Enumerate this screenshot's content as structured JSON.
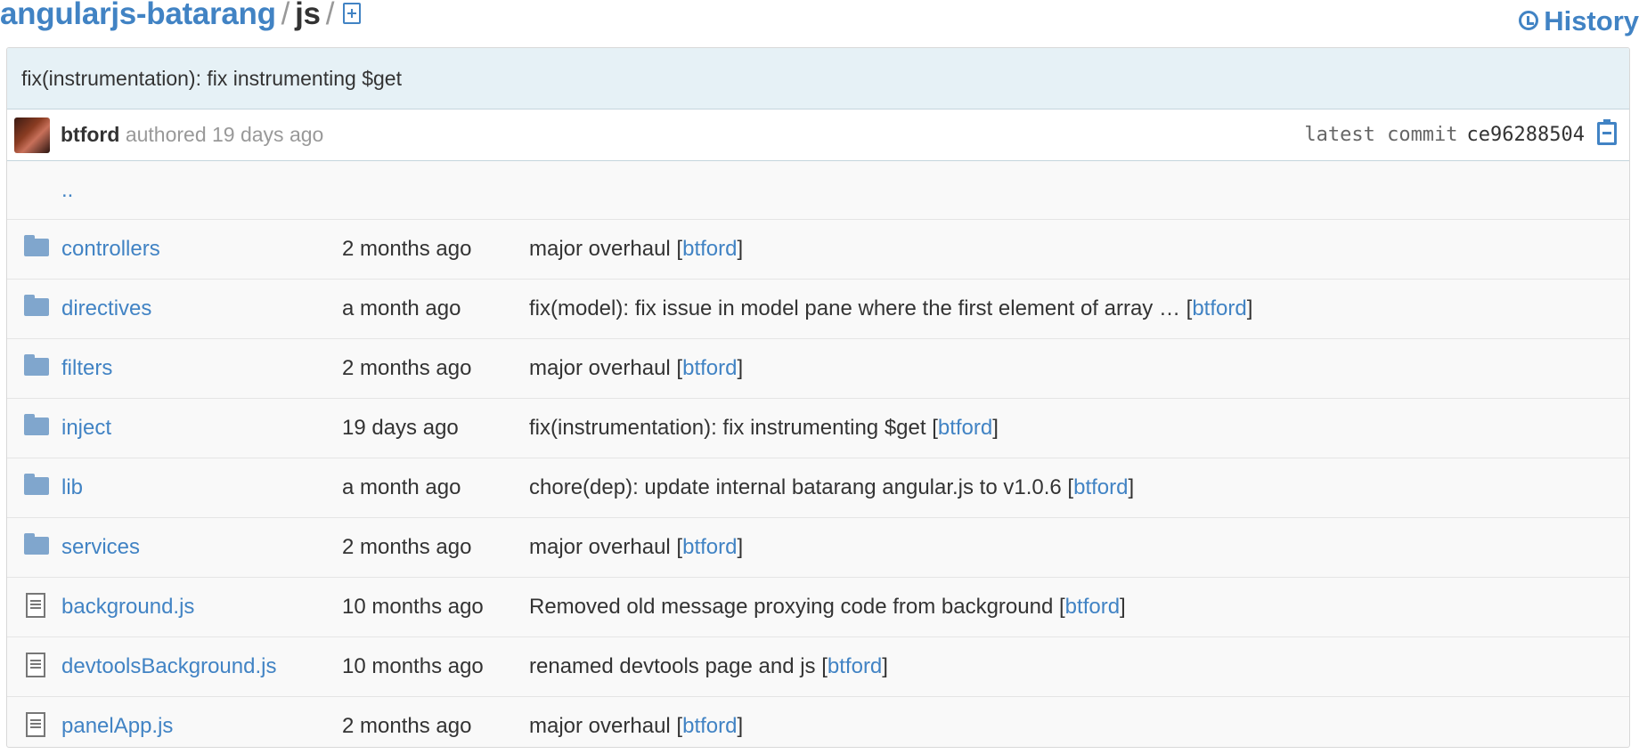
{
  "breadcrumb": {
    "repo": "angularjs-batarang",
    "separator": "/",
    "current": "js",
    "new_file_icon": "file-add-icon"
  },
  "history": {
    "label": "History",
    "icon": "history-clock-icon"
  },
  "commit": {
    "message": "fix(instrumentation): fix instrumenting $get",
    "author": "btford",
    "authored_text": "authored 19 days ago",
    "latest_label": "latest commit",
    "sha": "ce96288504",
    "copy_icon": "clipboard-icon"
  },
  "parent_dir": "..",
  "rows": [
    {
      "type": "folder",
      "name": "controllers",
      "age": "2 months ago",
      "message": "major overhaul",
      "author": "btford"
    },
    {
      "type": "folder",
      "name": "directives",
      "age": "a month ago",
      "message": "fix(model): fix issue in model pane where the first element of array …",
      "author": "btford"
    },
    {
      "type": "folder",
      "name": "filters",
      "age": "2 months ago",
      "message": "major overhaul",
      "author": "btford"
    },
    {
      "type": "folder",
      "name": "inject",
      "age": "19 days ago",
      "message": "fix(instrumentation): fix instrumenting $get",
      "author": "btford"
    },
    {
      "type": "folder",
      "name": "lib",
      "age": "a month ago",
      "message": "chore(dep): update internal batarang angular.js to v1.0.6",
      "author": "btford"
    },
    {
      "type": "folder",
      "name": "services",
      "age": "2 months ago",
      "message": "major overhaul",
      "author": "btford"
    },
    {
      "type": "file",
      "name": "background.js",
      "age": "10 months ago",
      "message": "Removed old message proxying code from background",
      "author": "btford"
    },
    {
      "type": "file",
      "name": "devtoolsBackground.js",
      "age": "10 months ago",
      "message": "renamed devtools page and js",
      "author": "btford"
    },
    {
      "type": "file",
      "name": "panelApp.js",
      "age": "2 months ago",
      "message": "major overhaul",
      "author": "btford"
    }
  ],
  "colors": {
    "link": "#4183c4",
    "commit_bar": "#e6f1f6",
    "folder": "#80a6cd"
  }
}
